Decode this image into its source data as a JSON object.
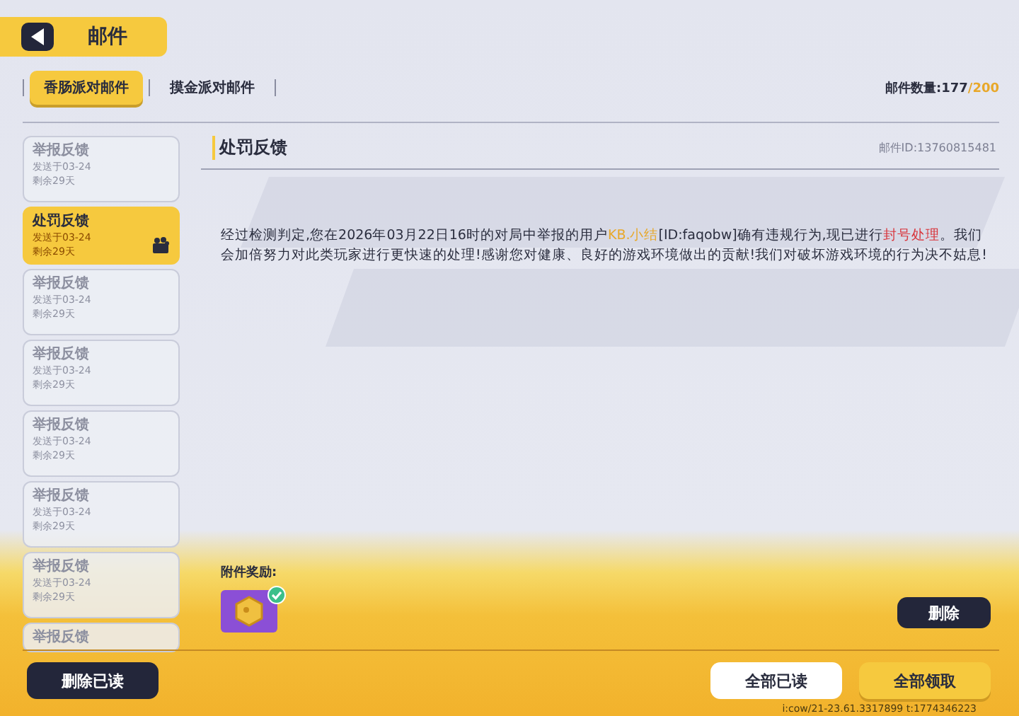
{
  "header": {
    "title": "邮件"
  },
  "tabs": [
    {
      "label": "香肠派对邮件",
      "selected": true
    },
    {
      "label": "摸金派对邮件",
      "selected": false
    }
  ],
  "mail_count": {
    "label": "邮件数量:",
    "current": "177",
    "max": "/200"
  },
  "mail_list": [
    {
      "title": "举报反馈",
      "sent": "发送于03-24",
      "remaining": "剩余29天",
      "selected": false,
      "read": true,
      "has_attachment": false
    },
    {
      "title": "处罚反馈",
      "sent": "发送于03-24",
      "remaining": "剩余29天",
      "selected": true,
      "read": false,
      "has_attachment": true
    },
    {
      "title": "举报反馈",
      "sent": "发送于03-24",
      "remaining": "剩余29天",
      "selected": false,
      "read": true,
      "has_attachment": false
    },
    {
      "title": "举报反馈",
      "sent": "发送于03-24",
      "remaining": "剩余29天",
      "selected": false,
      "read": true,
      "has_attachment": false
    },
    {
      "title": "举报反馈",
      "sent": "发送于03-24",
      "remaining": "剩余29天",
      "selected": false,
      "read": true,
      "has_attachment": false
    },
    {
      "title": "举报反馈",
      "sent": "发送于03-24",
      "remaining": "剩余29天",
      "selected": false,
      "read": true,
      "has_attachment": false
    },
    {
      "title": "举报反馈",
      "sent": "发送于03-24",
      "remaining": "剩余29天",
      "selected": false,
      "read": true,
      "has_attachment": false
    },
    {
      "title": "举报反馈",
      "selected": false,
      "read": true,
      "has_attachment": false
    }
  ],
  "mail": {
    "title": "处罚反馈",
    "id": "邮件ID:13760815481",
    "body": [
      {
        "kind": "plain",
        "text": "经过检测判定,您在2026年03月22日16时的对局中举报的用户"
      },
      {
        "kind": "player",
        "text": "KB.小结"
      },
      {
        "kind": "plain",
        "text": "[ID:faqobw]确有违规行为,现已进行"
      },
      {
        "kind": "penalty",
        "text": "封号处理"
      },
      {
        "kind": "plain",
        "text": "。我们会加倍努力对此类玩家进行更快速的处理!感谢您对健康、良好的游戏环境做出的贡献!我们对破坏游戏环境的行为决不姑息!"
      }
    ],
    "attachment_label": "附件奖励:",
    "attachments": [
      {
        "claimed": true
      }
    ],
    "delete_button": "删除"
  },
  "footer": {
    "delete_read_button": "删除已读",
    "read_all_button": "全部已读",
    "claim_all_button": "全部领取",
    "debug_text": "i:cow/21-23.61.3317899 t:1774346223"
  }
}
